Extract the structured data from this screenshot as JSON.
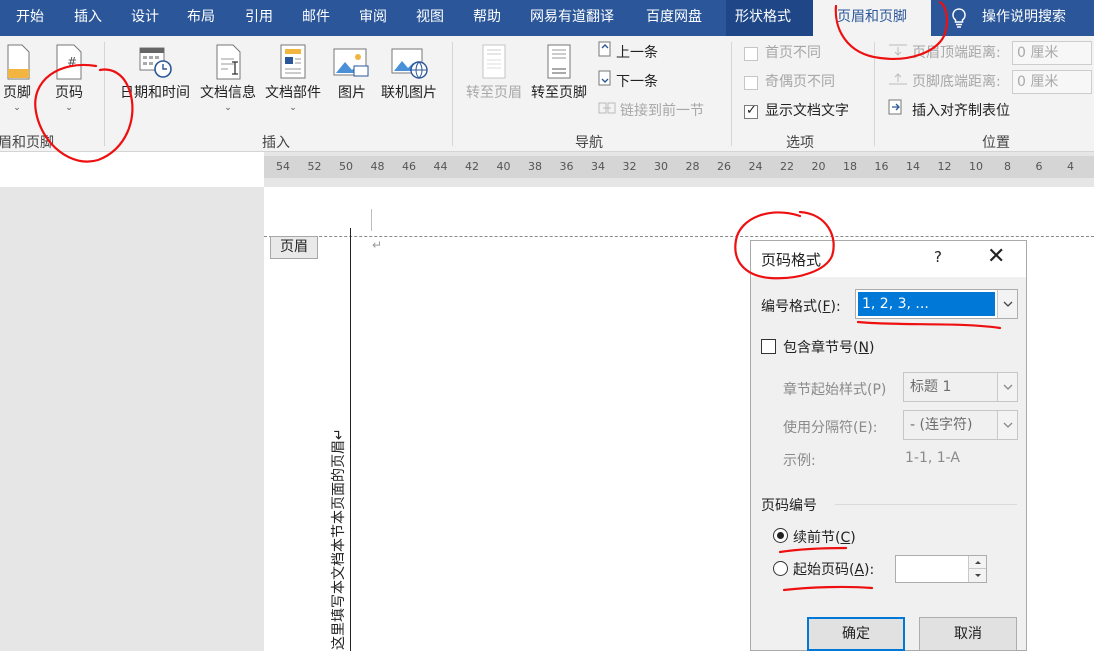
{
  "tabs": [
    {
      "label": "开始"
    },
    {
      "label": "插入"
    },
    {
      "label": "设计"
    },
    {
      "label": "布局"
    },
    {
      "label": "引用"
    },
    {
      "label": "邮件"
    },
    {
      "label": "审阅"
    },
    {
      "label": "视图"
    },
    {
      "label": "帮助"
    },
    {
      "label": "网易有道翻译"
    },
    {
      "label": "百度网盘"
    },
    {
      "label": "形状格式"
    },
    {
      "label": "页眉和页脚"
    }
  ],
  "search_label": "操作说明搜索",
  "ribbon": {
    "hf_group": {
      "footer_label": "页脚",
      "page_number_label": "页码",
      "group_label": "眉和页脚"
    },
    "insert_group": {
      "datetime_label": "日期和时间",
      "docinfo_label": "文档信息",
      "quickparts_label": "文档部件",
      "picture_label": "图片",
      "online_picture_label": "联机图片",
      "group_label": "插入"
    },
    "nav_group": {
      "goto_header_label": "转至页眉",
      "goto_footer_label": "转至页脚",
      "previous_label": "上一条",
      "next_label": "下一条",
      "link_previous_label": "链接到前一节",
      "group_label": "导航"
    },
    "options_group": {
      "first_page_label": "首页不同",
      "odd_even_label": "奇偶页不同",
      "show_doc_text_label": "显示文档文字",
      "group_label": "选项"
    },
    "position_group": {
      "header_top_label": "页眉顶端距离:",
      "footer_bottom_label": "页脚底端距离:",
      "header_top_value": "0 厘米",
      "footer_bottom_value": "0 厘米",
      "insert_align_tab_label": "插入对齐制表位",
      "group_label": "位置"
    }
  },
  "ruler_ticks": [
    "54",
    "52",
    "50",
    "48",
    "46",
    "44",
    "42",
    "40",
    "38",
    "36",
    "34",
    "32",
    "30",
    "28",
    "26",
    "24",
    "22",
    "20",
    "18",
    "16",
    "14",
    "12",
    "10",
    "8",
    "6",
    "4"
  ],
  "document": {
    "header_tag": "页眉",
    "paragraph_mark": "↵",
    "vertical_text": "这里填写本文档本节本页面的页眉↵"
  },
  "dialog": {
    "title": "页码格式",
    "help": "?",
    "close": "✕",
    "number_format_label": "编号格式(",
    "number_format_accel": "F",
    "number_format_tail": "):",
    "number_format_value": "1, 2, 3, ...",
    "include_chapter_label": "包含章节号(",
    "include_chapter_accel": "N",
    "include_chapter_tail": ")",
    "chapter_style_label": "章节起始样式(P)",
    "chapter_style_value": "标题 1",
    "separator_label": "使用分隔符(E):",
    "separator_value": "-  (连字符)",
    "example_label": "示例:",
    "example_value": "1-1, 1-A",
    "numbering_section": "页码编号",
    "continue_label": "续前节(",
    "continue_accel": "C",
    "continue_tail": ")",
    "start_at_label": "起始页码(",
    "start_at_accel": "A",
    "start_at_tail": "):",
    "start_at_value": "",
    "ok_label": "确定",
    "cancel_label": "取消"
  }
}
